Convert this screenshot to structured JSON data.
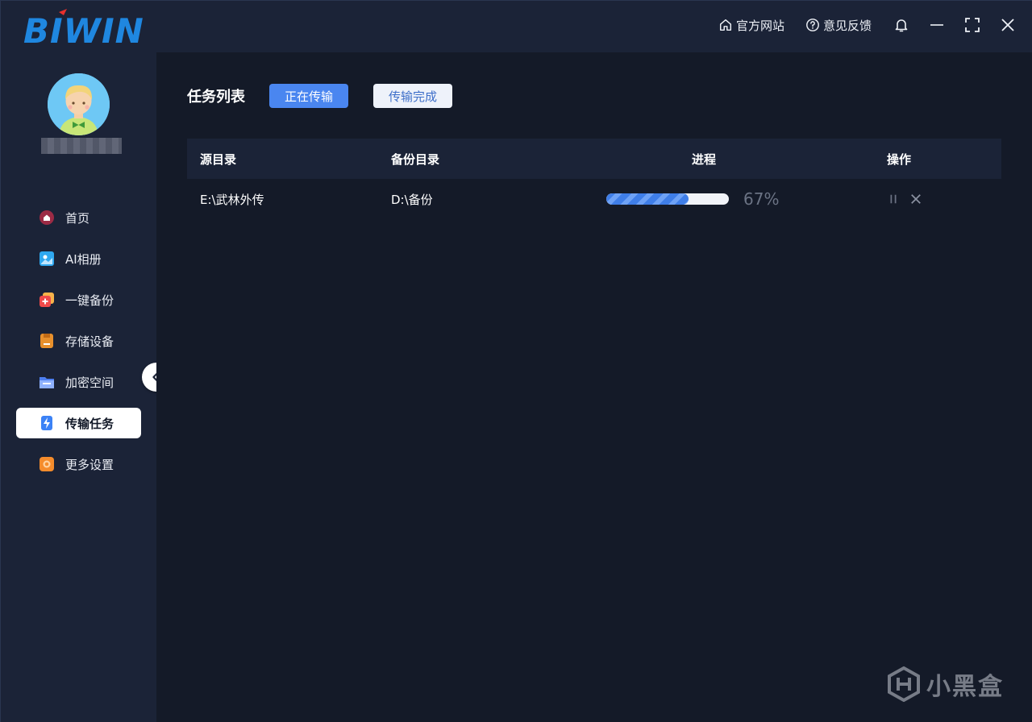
{
  "app": {
    "logo_text": "BIWIN"
  },
  "titlebar": {
    "links": [
      {
        "label": "官方网站",
        "icon": "home-icon"
      },
      {
        "label": "意见反馈",
        "icon": "help-circle-icon"
      }
    ],
    "controls": [
      "bell-icon",
      "minimize-icon",
      "maximize-icon",
      "close-icon"
    ]
  },
  "sidebar": {
    "items": [
      {
        "label": "首页",
        "icon": "home-icon",
        "color": "#c0334d"
      },
      {
        "label": "AI相册",
        "icon": "album-icon",
        "color": "#2fa8f0"
      },
      {
        "label": "一键备份",
        "icon": "backup-icon",
        "color": "#f04a4a"
      },
      {
        "label": "存储设备",
        "icon": "storage-icon",
        "color": "#e8902c"
      },
      {
        "label": "加密空间",
        "icon": "folder-lock-icon",
        "color": "#4d7ff0"
      },
      {
        "label": "传输任务",
        "icon": "transfer-icon",
        "color": "#3b82f6",
        "active": true
      },
      {
        "label": "更多设置",
        "icon": "settings-icon",
        "color": "#f58c2c"
      }
    ]
  },
  "main": {
    "list_title": "任务列表",
    "tabs": [
      {
        "label": "正在传输",
        "active": true
      },
      {
        "label": "传输完成",
        "active": false
      }
    ],
    "table": {
      "headers": [
        "源目录",
        "备份目录",
        "进程",
        "操作"
      ],
      "rows": [
        {
          "source": "E:\\武林外传",
          "target": "D:\\备份",
          "progress": 0.67,
          "progress_label": "67%"
        }
      ]
    }
  },
  "watermark": {
    "text": "小黑盒"
  },
  "colors": {
    "accent": "#4a86f0",
    "sidebar_bg": "#1b2337",
    "main_bg": "#141a28"
  }
}
